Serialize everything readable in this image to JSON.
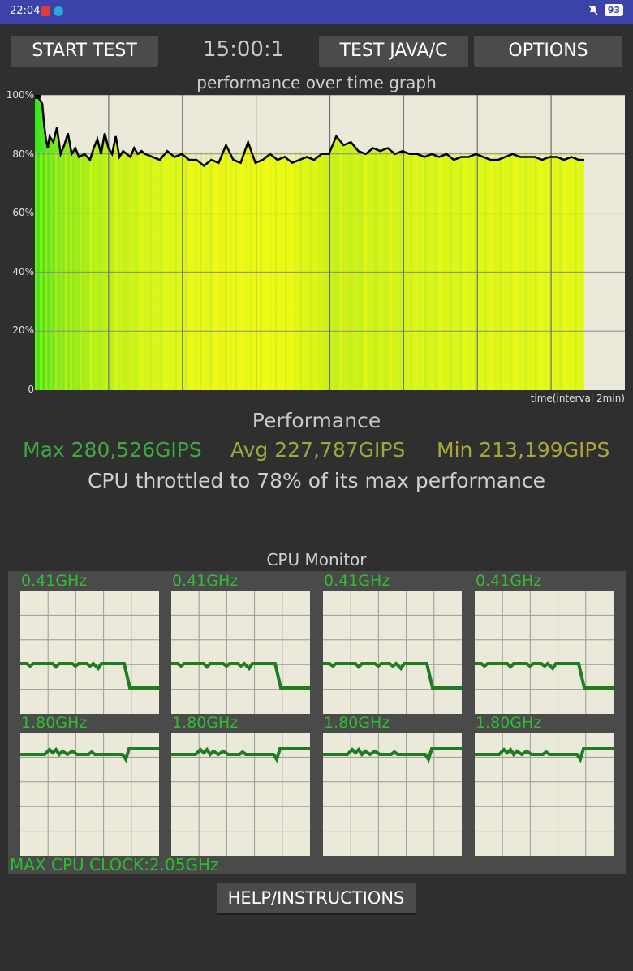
{
  "status": {
    "time": "22:04",
    "battery": "93"
  },
  "toolbar": {
    "start_label": "START TEST",
    "timer": "15:00:1",
    "test_label": "TEST JAVA/C",
    "options_label": "OPTIONS"
  },
  "graph": {
    "title": "performance over time graph",
    "y_ticks": [
      "100%",
      "80%",
      "60%",
      "40%",
      "20%",
      "0"
    ],
    "x_caption": "time(interval 2min)"
  },
  "chart_data": {
    "type": "area",
    "title": "performance over time graph",
    "xlabel": "time(interval 2min)",
    "ylabel": "",
    "ylim": [
      0,
      100
    ],
    "y_ticks": [
      0,
      20,
      40,
      60,
      80,
      100
    ],
    "x_range": [
      0,
      15
    ],
    "grid": true,
    "series": [
      {
        "x": [
          0,
          0.1,
          0.2,
          0.25,
          0.3,
          0.35,
          0.4,
          0.5,
          0.6,
          0.7,
          0.8,
          0.9,
          1.0,
          1.1,
          1.2,
          1.35,
          1.5,
          1.6,
          1.7,
          1.8,
          1.9,
          2.0,
          2.1,
          2.2,
          2.3,
          2.4,
          2.5,
          2.6,
          2.7,
          2.8,
          2.9,
          3.0,
          3.2,
          3.4,
          3.6,
          3.8,
          4.0,
          4.2,
          4.4,
          4.6,
          4.8,
          5.0,
          5.2,
          5.4,
          5.6,
          5.8,
          6.0,
          6.2,
          6.4,
          6.6,
          6.8,
          7.0,
          7.2,
          7.4,
          7.6,
          7.8,
          8.0,
          8.2,
          8.4,
          8.6,
          8.8,
          9.0,
          9.2,
          9.4,
          9.6,
          9.8,
          10.0,
          10.2,
          10.4,
          10.6,
          10.8,
          11.0,
          11.2,
          11.4,
          11.6,
          11.8,
          12.0,
          12.2,
          12.4,
          12.6,
          12.8,
          13.0,
          13.2,
          13.4,
          13.6,
          13.8,
          14.0,
          14.2,
          14.4,
          14.6,
          14.8,
          14.95
        ],
        "values": [
          99,
          99,
          97,
          90,
          85,
          82,
          86,
          84,
          89,
          80,
          83,
          87,
          80,
          82,
          79,
          80,
          78,
          82,
          85,
          80,
          87,
          82,
          80,
          86,
          79,
          81,
          80,
          79,
          82,
          80,
          81,
          80,
          79,
          78,
          81,
          79,
          80,
          78,
          78,
          76,
          78,
          77,
          83,
          78,
          77,
          84,
          77,
          78,
          80,
          78,
          79,
          77,
          78,
          79,
          78,
          80,
          80,
          86,
          83,
          84,
          81,
          80,
          82,
          81,
          82,
          80,
          81,
          80,
          80,
          79,
          80,
          79,
          80,
          78,
          79,
          79,
          80,
          79,
          78,
          78,
          79,
          80,
          79,
          79,
          79,
          78,
          79,
          79,
          78,
          79,
          78,
          78
        ]
      }
    ]
  },
  "performance": {
    "title": "Performance",
    "max": "Max 280,526GIPS",
    "avg": "Avg 227,787GIPS",
    "min": "Min 213,199GIPS",
    "throttle": "CPU throttled to 78% of its max performance"
  },
  "colors": {
    "max": "#3fa93f",
    "avg": "#9ea83a",
    "min": "#a8a83a",
    "cpu_line": "#1e7d1e"
  },
  "cpu_monitor": {
    "title": "CPU Monitor",
    "cores": [
      {
        "freq": "0.41GHz"
      },
      {
        "freq": "0.41GHz"
      },
      {
        "freq": "0.41GHz"
      },
      {
        "freq": "0.41GHz"
      },
      {
        "freq": "1.80GHz"
      },
      {
        "freq": "1.80GHz"
      },
      {
        "freq": "1.80GHz"
      },
      {
        "freq": "1.80GHz"
      }
    ],
    "max_clock": "MAX CPU CLOCK:2.05GHz"
  },
  "help_label": "HELP/INSTRUCTIONS"
}
